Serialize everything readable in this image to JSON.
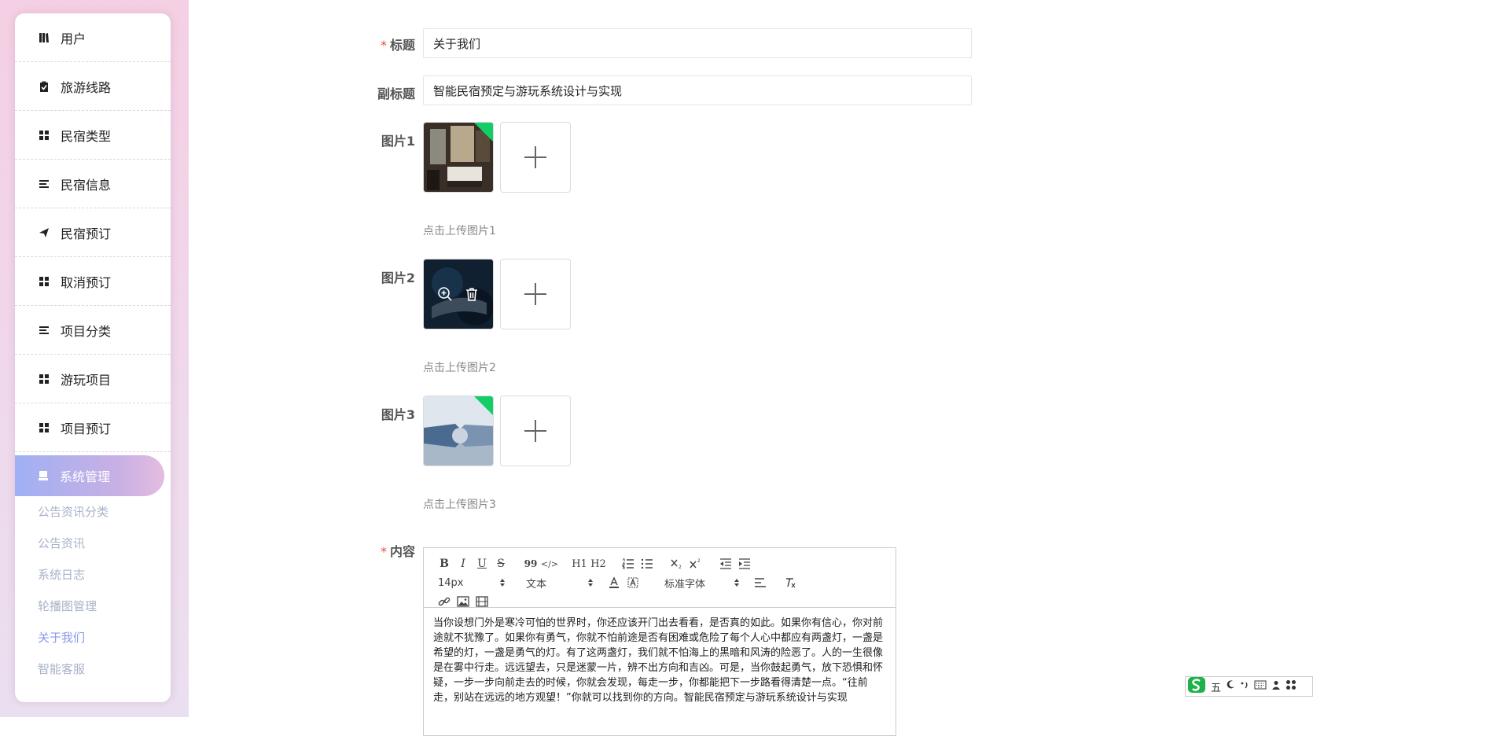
{
  "sidebar": {
    "items": [
      {
        "label": "用户",
        "icon": "book-icon"
      },
      {
        "label": "旅游线路",
        "icon": "clipboard-icon"
      },
      {
        "label": "民宿类型",
        "icon": "grid-icon"
      },
      {
        "label": "民宿信息",
        "icon": "list-icon"
      },
      {
        "label": "民宿预订",
        "icon": "send-icon"
      },
      {
        "label": "取消预订",
        "icon": "grid-icon"
      },
      {
        "label": "项目分类",
        "icon": "list-icon"
      },
      {
        "label": "游玩项目",
        "icon": "grid-icon"
      },
      {
        "label": "项目预订",
        "icon": "grid-icon"
      }
    ],
    "active": {
      "label": "系统管理",
      "icon": "system-icon"
    },
    "submenu": [
      "公告资讯分类",
      "公告资讯",
      "系统日志",
      "轮播图管理",
      "关于我们",
      "智能客服"
    ]
  },
  "form": {
    "title_label": "标题",
    "title_value": "关于我们",
    "subtitle_label": "副标题",
    "subtitle_value": "智能民宿预定与游玩系统设计与实现",
    "image1_label": "图片1",
    "image1_tip": "点击上传图片1",
    "image2_label": "图片2",
    "image2_tip": "点击上传图片2",
    "image3_label": "图片3",
    "image3_tip": "点击上传图片3",
    "content_label": "内容",
    "required_mark": "*"
  },
  "editor": {
    "font_size": "14px",
    "paragraph": "文本",
    "font_family": "标准字体",
    "btn_h1": "H1",
    "btn_h2": "H2",
    "btn_quote": "99",
    "btn_code": "</>",
    "btn_bold": "B",
    "btn_italic": "I",
    "btn_underline": "U",
    "btn_strike": "S",
    "content": "当你设想门外是寒冷可怕的世界时，你还应该开门出去看看，是否真的如此。如果你有信心，你对前途就不犹豫了。如果你有勇气，你就不怕前途是否有困难或危险了每个人心中都应有两盏灯，一盏是希望的灯，一盏是勇气的灯。有了这两盏灯，我们就不怕海上的黑暗和风涛的险恶了。人的一生很像是在雾中行走。远远望去，只是迷蒙一片，辨不出方向和吉凶。可是，当你鼓起勇气，放下恐惧和怀疑，一步一步向前走去的时候，你就会发现，每走一步，你都能把下一步路看得清楚一点。“往前走，别站在远远的地方观望！”你就可以找到你的方向。智能民宿预定与游玩系统设计与实现"
  },
  "ime": {
    "mode": "五"
  },
  "colors": {
    "accent_gradient_start": "#9fb0f4",
    "accent_gradient_end": "#e3bde0",
    "required": "#e74c3c",
    "corner_badge": "#13ce66"
  }
}
